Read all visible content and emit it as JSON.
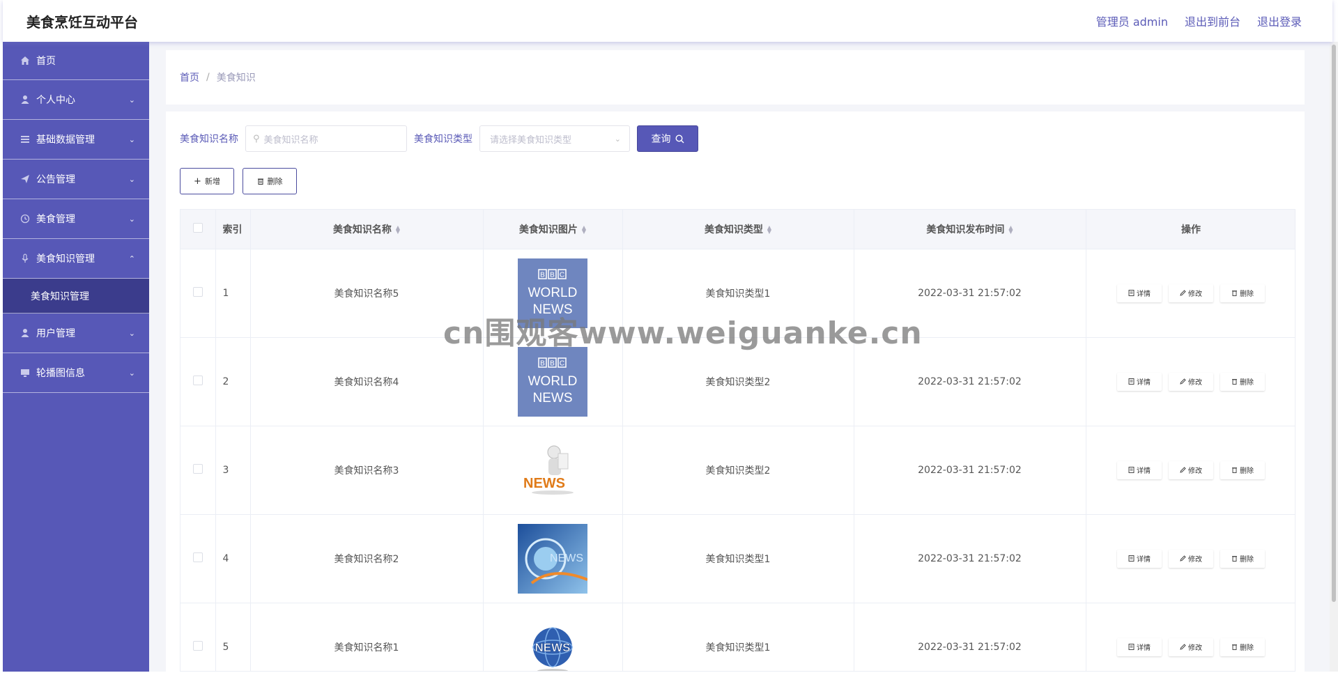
{
  "header": {
    "title": "美食烹饪互动平台",
    "admin_label": "管理员 admin",
    "to_front_label": "退出到前台",
    "logout_label": "退出登录"
  },
  "sidebar": {
    "items": [
      {
        "label": "首页",
        "icon": "home-icon"
      },
      {
        "label": "个人中心",
        "icon": "user-icon"
      },
      {
        "label": "基础数据管理",
        "icon": "list-icon"
      },
      {
        "label": "公告管理",
        "icon": "send-icon"
      },
      {
        "label": "美食管理",
        "icon": "clock-icon"
      },
      {
        "label": "美食知识管理",
        "icon": "mic-icon"
      },
      {
        "label": "用户管理",
        "icon": "user-icon"
      },
      {
        "label": "轮播图信息",
        "icon": "monitor-icon"
      }
    ],
    "submenu_active": "美食知识管理"
  },
  "breadcrumb": {
    "home": "首页",
    "separator": "/",
    "current": "美食知识"
  },
  "search": {
    "name_label": "美食知识名称",
    "name_placeholder": "美食知识名称",
    "type_label": "美食知识类型",
    "type_placeholder": "请选择美食知识类型",
    "query_label": "查询"
  },
  "actions": {
    "add_label": "新增",
    "delete_label": "删除"
  },
  "table": {
    "headers": {
      "index": "索引",
      "name": "美食知识名称",
      "image": "美食知识图片",
      "type": "美食知识类型",
      "time": "美食知识发布时间",
      "ops": "操作"
    },
    "op_labels": {
      "detail": "详情",
      "edit": "修改",
      "delete": "删除"
    },
    "rows": [
      {
        "index": "1",
        "name": "美食知识名称5",
        "image": "bbc-world-news",
        "type": "美食知识类型1",
        "time": "2022-03-31 21:57:02"
      },
      {
        "index": "2",
        "name": "美食知识名称4",
        "image": "bbc-world-news",
        "type": "美食知识类型2",
        "time": "2022-03-31 21:57:02"
      },
      {
        "index": "3",
        "name": "美食知识名称3",
        "image": "news-figure",
        "type": "美食知识类型2",
        "time": "2022-03-31 21:57:02"
      },
      {
        "index": "4",
        "name": "美食知识名称2",
        "image": "news-globe-blue",
        "type": "美食知识类型1",
        "time": "2022-03-31 21:57:02"
      },
      {
        "index": "5",
        "name": "美食知识名称1",
        "image": "news-globe",
        "type": "美食知识类型1",
        "time": "2022-03-31 21:57:02"
      }
    ]
  },
  "watermark": "cn围观客www.weiguanke.cn",
  "colors": {
    "primary": "#5758b7",
    "submenu_active": "#3b3c8c"
  }
}
